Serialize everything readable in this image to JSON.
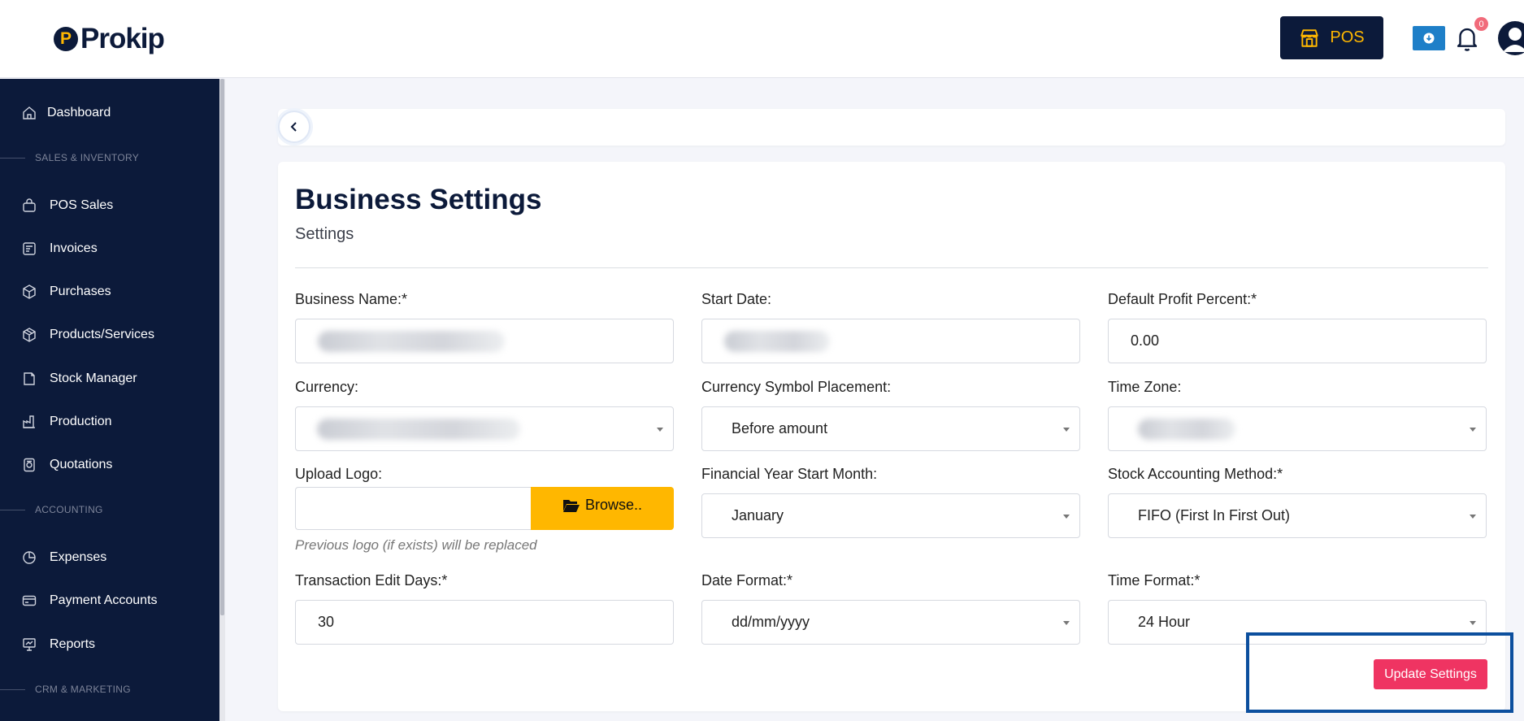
{
  "header": {
    "logo_text": "Prokip",
    "pos_label": "POS",
    "notification_count": "0"
  },
  "sidebar": {
    "items": [
      {
        "label": "Dashboard",
        "icon": "home-icon"
      },
      {
        "section": "SALES & INVENTORY"
      },
      {
        "label": "POS Sales",
        "icon": "bag-icon"
      },
      {
        "label": "Invoices",
        "icon": "invoice-icon"
      },
      {
        "label": "Purchases",
        "icon": "purchase-box-icon"
      },
      {
        "label": "Products/Services",
        "icon": "box-icon"
      },
      {
        "label": "Stock Manager",
        "icon": "stock-icon"
      },
      {
        "label": "Production",
        "icon": "factory-icon"
      },
      {
        "label": "Quotations",
        "icon": "quotation-icon"
      },
      {
        "section": "ACCOUNTING"
      },
      {
        "label": "Expenses",
        "icon": "pie-icon"
      },
      {
        "label": "Payment Accounts",
        "icon": "card-icon"
      },
      {
        "label": "Reports",
        "icon": "presentation-icon"
      },
      {
        "section": "CRM & MARKETING"
      }
    ]
  },
  "main": {
    "title": "Business Settings",
    "subtitle": "Settings",
    "fields": {
      "business_name": {
        "label": "Business Name:*",
        "value": ""
      },
      "start_date": {
        "label": "Start Date:",
        "value": ""
      },
      "default_profit_percent": {
        "label": "Default Profit Percent:*",
        "value": "0.00"
      },
      "currency": {
        "label": "Currency:",
        "value": ""
      },
      "currency_symbol_placement": {
        "label": "Currency Symbol Placement:",
        "value": "Before amount"
      },
      "time_zone": {
        "label": "Time Zone:",
        "value": ""
      },
      "upload_logo": {
        "label": "Upload Logo:",
        "button": "Browse..",
        "help": "Previous logo (if exists) will be replaced"
      },
      "financial_year_start_month": {
        "label": "Financial Year Start Month:",
        "value": "January"
      },
      "stock_accounting_method": {
        "label": "Stock Accounting Method:*",
        "value": "FIFO (First In First Out)"
      },
      "transaction_edit_days": {
        "label": "Transaction Edit Days:*",
        "value": "30"
      },
      "date_format": {
        "label": "Date Format:*",
        "value": "dd/mm/yyyy"
      },
      "time_format": {
        "label": "Time Format:*",
        "value": "24 Hour"
      }
    },
    "update_button": "Update Settings"
  },
  "colors": {
    "navy": "#0c1a3a",
    "accent_yellow": "#ffb700",
    "update_red": "#ef3462",
    "highlight_blue": "#0c4f9e"
  }
}
